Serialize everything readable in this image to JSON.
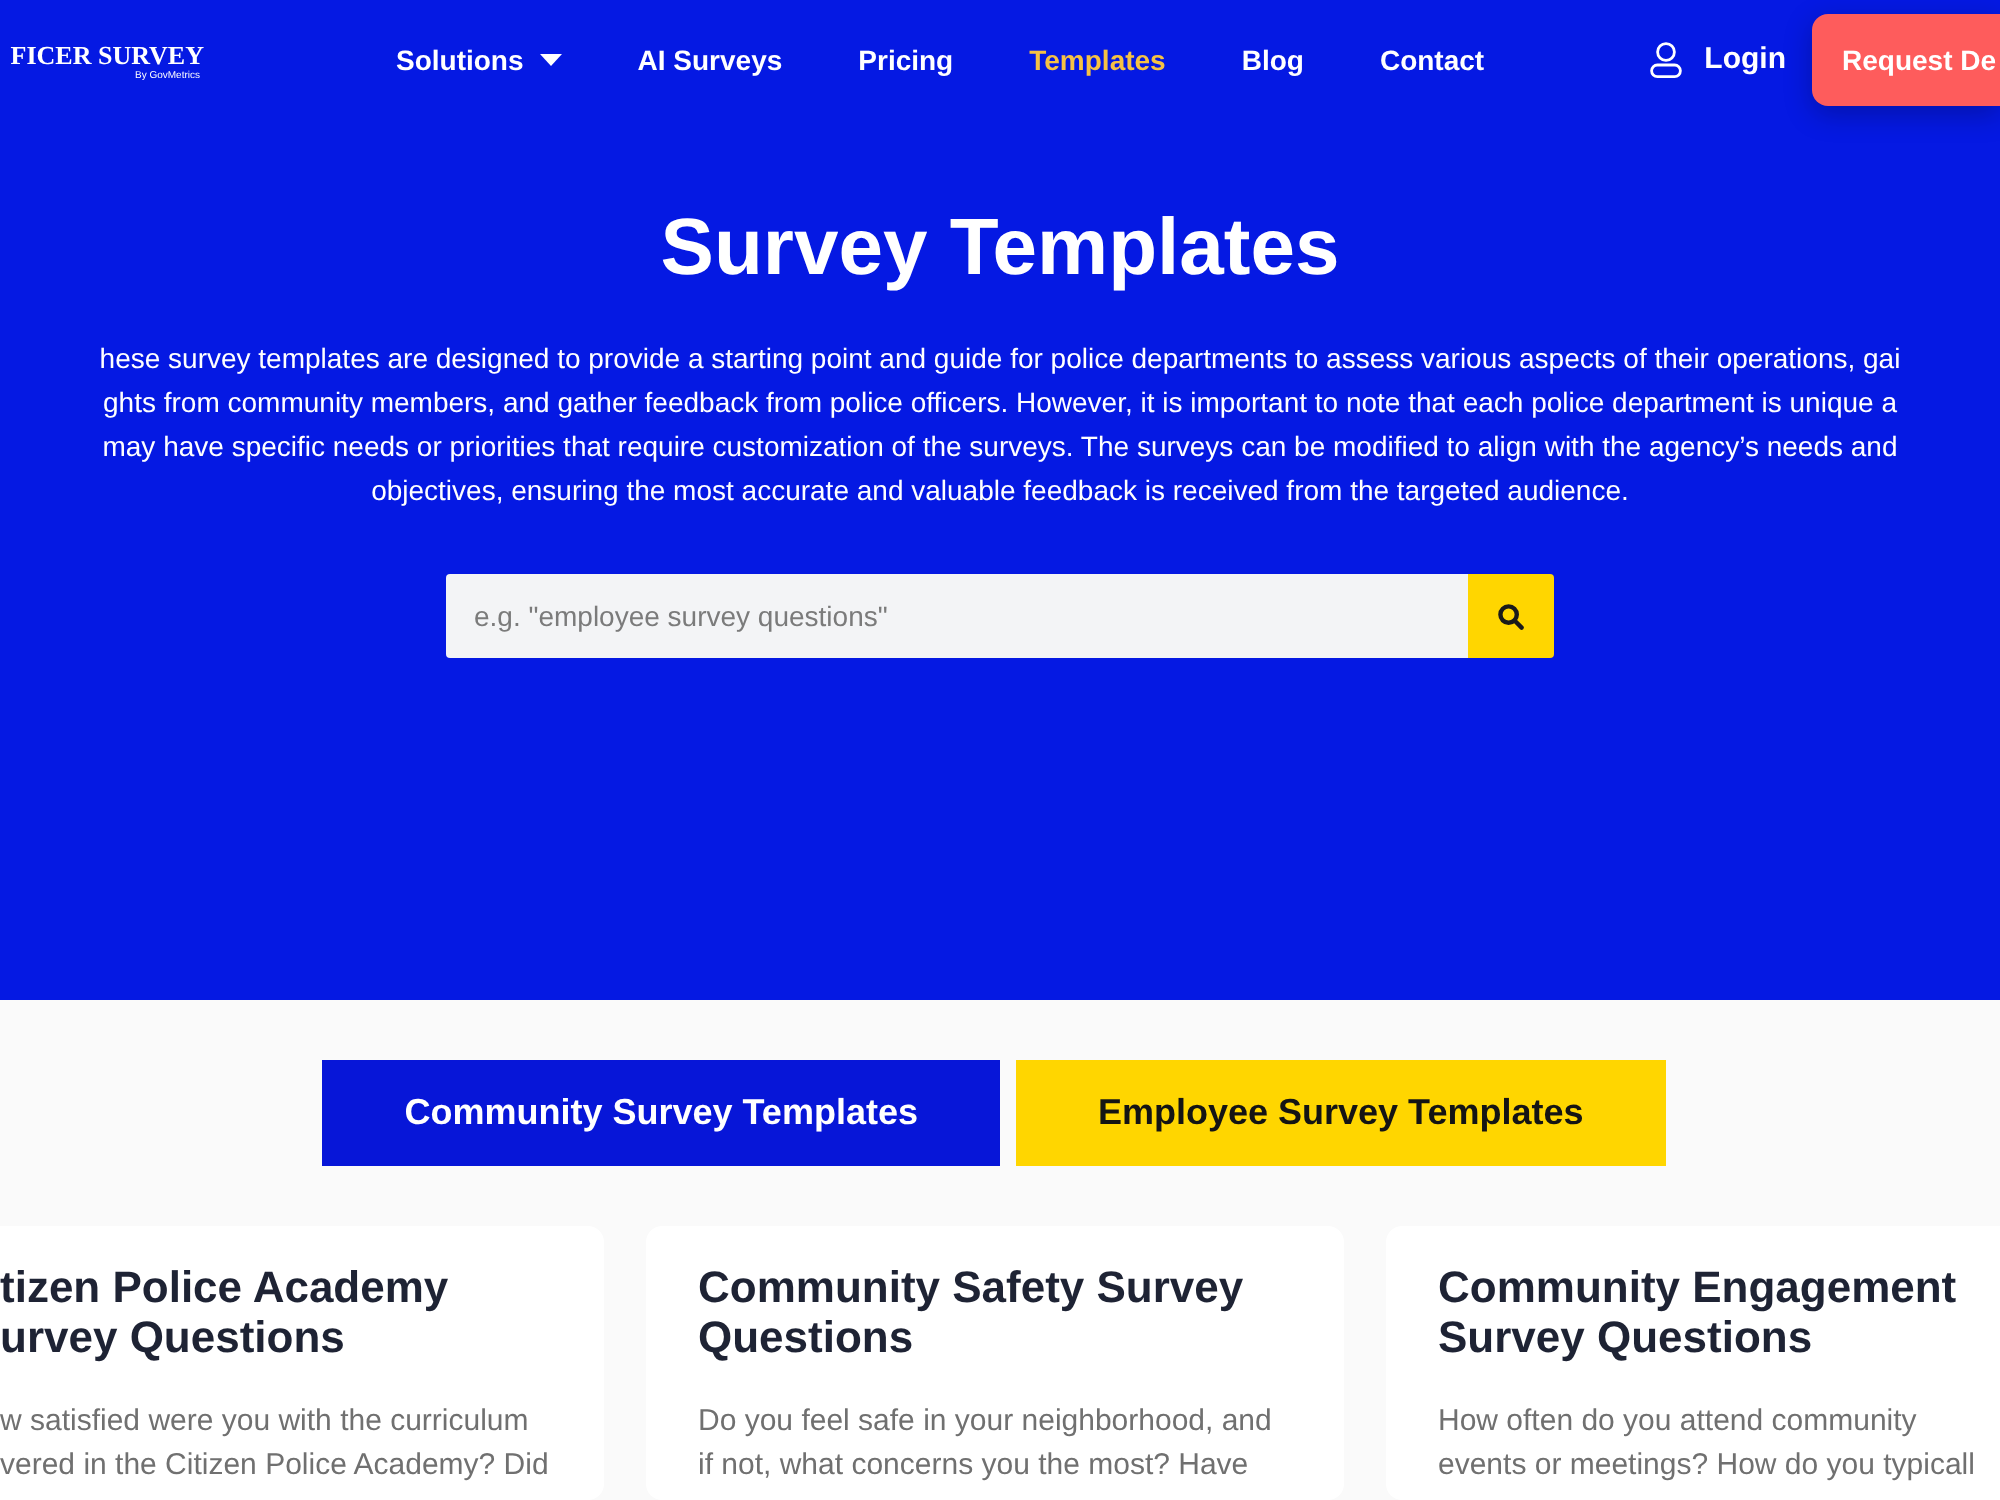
{
  "header": {
    "logo": {
      "title": "FICER SURVEY",
      "subtitle": "By GovMetrics"
    },
    "nav": [
      {
        "label": "Solutions",
        "has_menu": true,
        "selected": false
      },
      {
        "label": "AI Surveys",
        "has_menu": false,
        "selected": false
      },
      {
        "label": "Pricing",
        "has_menu": false,
        "selected": false
      },
      {
        "label": "Templates",
        "has_menu": false,
        "selected": true
      },
      {
        "label": "Blog",
        "has_menu": false,
        "selected": false
      },
      {
        "label": "Contact",
        "has_menu": false,
        "selected": false
      }
    ],
    "login": "Login",
    "cta": "Request De"
  },
  "hero": {
    "title": "Survey Templates",
    "intro_lines": [
      "hese survey templates are designed to provide a starting point and guide for police departments to assess various aspects of their operations, gai",
      "ghts from community members, and gather feedback from police officers. However, it is important to note that each police department is unique a",
      "may have specific needs or priorities that require customization of the surveys. The surveys can be modified to align with the agency’s needs and",
      "objectives, ensuring the most accurate and valuable feedback is received from the targeted audience."
    ],
    "search": {
      "placeholder": "e.g. \"employee survey questions\""
    }
  },
  "tabs": [
    {
      "label": "Community Survey Templates",
      "selected": true
    },
    {
      "label": "Employee Survey Templates",
      "selected": false
    }
  ],
  "cards": [
    {
      "title_lines": [
        "tizen Police Academy",
        "urvey Questions"
      ],
      "text_lines": [
        "w satisfied were you with the curriculum",
        "vered in the Citizen Police Academy? Did"
      ]
    },
    {
      "title_lines": [
        "Community Safety Survey",
        "Questions"
      ],
      "text_lines": [
        "Do you feel safe in your neighborhood, and",
        "if not, what concerns you the most? Have"
      ]
    },
    {
      "title_lines": [
        "Community Engagement",
        "Survey Questions"
      ],
      "text_lines": [
        "How often do you attend community",
        "events or meetings? How do you typicall"
      ]
    }
  ]
}
